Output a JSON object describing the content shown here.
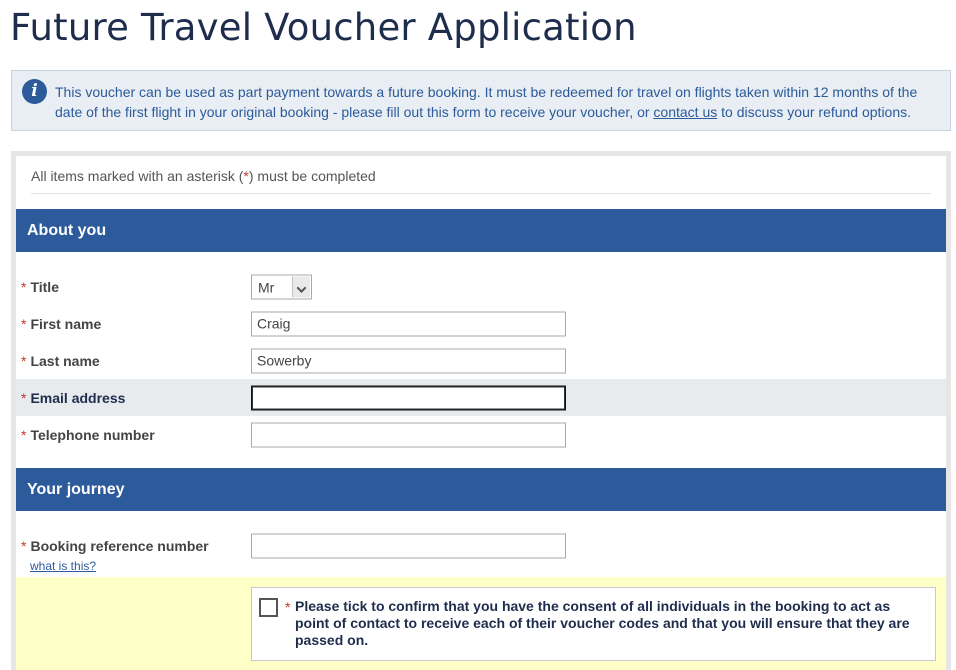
{
  "page": {
    "title": "Future Travel Voucher Application"
  },
  "info": {
    "icon": "info-icon",
    "text_before_link": "This voucher can be used as part payment towards a future booking. It must be redeemed for travel on flights taken within 12 months of the date of the first flight in your original booking - please fill out this form to receive your voucher, or ",
    "link_label": "contact us",
    "text_after_link": " to discuss your refund options."
  },
  "form": {
    "required_note_before": "All items marked with an asterisk (",
    "required_star": "*",
    "required_note_after": ") must be completed",
    "about_you": {
      "heading": "About you",
      "title_label": "Title",
      "title_value": "Mr",
      "first_name_label": "First name",
      "first_name_value": "Craig",
      "last_name_label": "Last name",
      "last_name_value": "Sowerby",
      "email_label": "Email address",
      "email_value": "",
      "phone_label": "Telephone number",
      "phone_value": ""
    },
    "your_journey": {
      "heading": "Your journey",
      "booking_ref_label": "Booking reference number",
      "booking_ref_value": "",
      "what_is_this_link": "what is this?",
      "consent_text": "Please tick to confirm that you have the consent of all individuals in the booking to act as point of contact to receive each of their voucher codes and that you will ensure that they are passed on.",
      "consent_checked": false
    }
  },
  "colors": {
    "brand_blue": "#2c5a9a",
    "title_navy": "#1f2d4d",
    "required_red": "#c0392b",
    "consent_yellow": "#ffffc8"
  }
}
